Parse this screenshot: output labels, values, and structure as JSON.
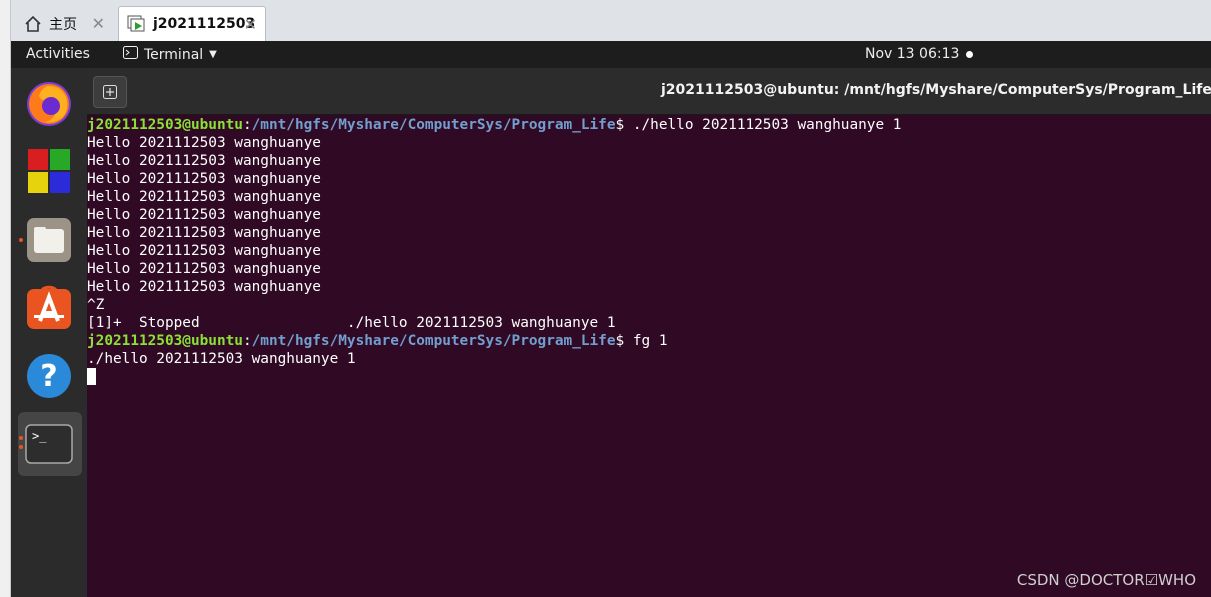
{
  "vm_tabs": [
    {
      "label": "主页",
      "icon": "home-icon",
      "active": false
    },
    {
      "label": "j2021112503",
      "icon": "vm-icon",
      "active": true
    }
  ],
  "topbar": {
    "activities": "Activities",
    "app_menu": "Terminal",
    "clock": "Nov 13  06:13"
  },
  "dock": [
    {
      "name": "firefox",
      "icon": "firefox-icon",
      "running": false
    },
    {
      "name": "app-grid-colored",
      "icon": "colored-squares-icon",
      "running": false
    },
    {
      "name": "files",
      "icon": "files-icon",
      "running": true
    },
    {
      "name": "software",
      "icon": "software-store-icon",
      "running": false
    },
    {
      "name": "help",
      "icon": "help-icon",
      "running": false
    },
    {
      "name": "terminal",
      "icon": "terminal-icon",
      "running": true
    }
  ],
  "terminal": {
    "title": "j2021112503@ubuntu: /mnt/hgfs/Myshare/ComputerSys/Program_Life",
    "prompt_user": "j2021112503@ubuntu",
    "prompt_path": "/mnt/hgfs/Myshare/ComputerSys/Program_Life",
    "cmd1": " ./hello 2021112503 wanghuanye 1",
    "output": [
      "Hello 2021112503 wanghuanye",
      "Hello 2021112503 wanghuanye",
      "Hello 2021112503 wanghuanye",
      "Hello 2021112503 wanghuanye",
      "Hello 2021112503 wanghuanye",
      "Hello 2021112503 wanghuanye",
      "Hello 2021112503 wanghuanye",
      "Hello 2021112503 wanghuanye",
      "Hello 2021112503 wanghuanye",
      "^Z",
      "[1]+  Stopped                 ./hello 2021112503 wanghuanye 1"
    ],
    "cmd2": " fg 1",
    "resume_line": "./hello 2021112503 wanghuanye 1"
  },
  "watermark": "CSDN @DOCTOR☑WHO"
}
